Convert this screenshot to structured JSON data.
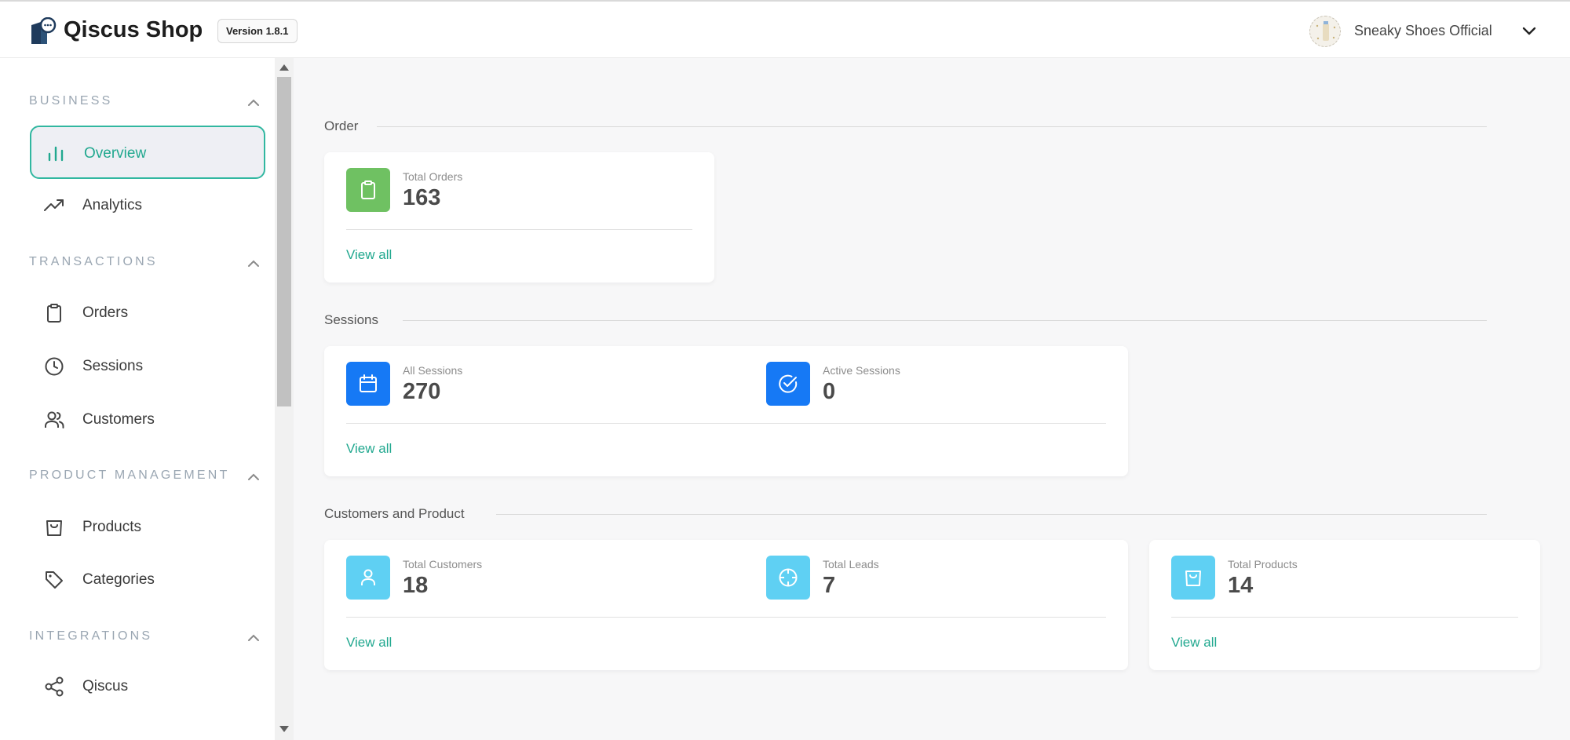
{
  "header": {
    "app_title": "Qiscus Shop",
    "version": "Version 1.8.1",
    "shop_name": "Sneaky Shoes Official"
  },
  "sidebar": {
    "sections": [
      {
        "label": "BUSINESS",
        "items": [
          {
            "label": "Overview",
            "icon": "bar-chart-icon",
            "active": true
          },
          {
            "label": "Analytics",
            "icon": "trending-up-icon"
          }
        ]
      },
      {
        "label": "TRANSACTIONS",
        "items": [
          {
            "label": "Orders",
            "icon": "clipboard-icon"
          },
          {
            "label": "Sessions",
            "icon": "clock-icon"
          },
          {
            "label": "Customers",
            "icon": "users-icon"
          }
        ]
      },
      {
        "label": "PRODUCT MANAGEMENT",
        "items": [
          {
            "label": "Products",
            "icon": "shopping-bag-icon"
          },
          {
            "label": "Categories",
            "icon": "tag-icon"
          }
        ]
      },
      {
        "label": "INTEGRATIONS",
        "items": [
          {
            "label": "Qiscus",
            "icon": "share-icon"
          }
        ]
      }
    ]
  },
  "main": {
    "groups": {
      "order": {
        "title": "Order",
        "stats": [
          {
            "label": "Total Orders",
            "value": "163",
            "icon": "clipboard-icon"
          }
        ],
        "view_all": "View all"
      },
      "sessions": {
        "title": "Sessions",
        "stats": [
          {
            "label": "All Sessions",
            "value": "270",
            "icon": "calendar-icon"
          },
          {
            "label": "Active Sessions",
            "value": "0",
            "icon": "check-circle-icon"
          }
        ],
        "view_all": "View all"
      },
      "customers": {
        "title": "Customers and Product",
        "stats": [
          {
            "label": "Total Customers",
            "value": "18",
            "icon": "user-icon"
          },
          {
            "label": "Total Leads",
            "value": "7",
            "icon": "crosshair-icon"
          }
        ],
        "view_all": "View all"
      },
      "products": {
        "stats": [
          {
            "label": "Total Products",
            "value": "14",
            "icon": "shopping-bag-icon"
          }
        ],
        "view_all": "View all"
      }
    }
  },
  "colors": {
    "accent": "#21a88f",
    "green_icon": "#6fc162",
    "blue_icon": "#1679f5",
    "cyan_icon": "#5fd0f3"
  }
}
